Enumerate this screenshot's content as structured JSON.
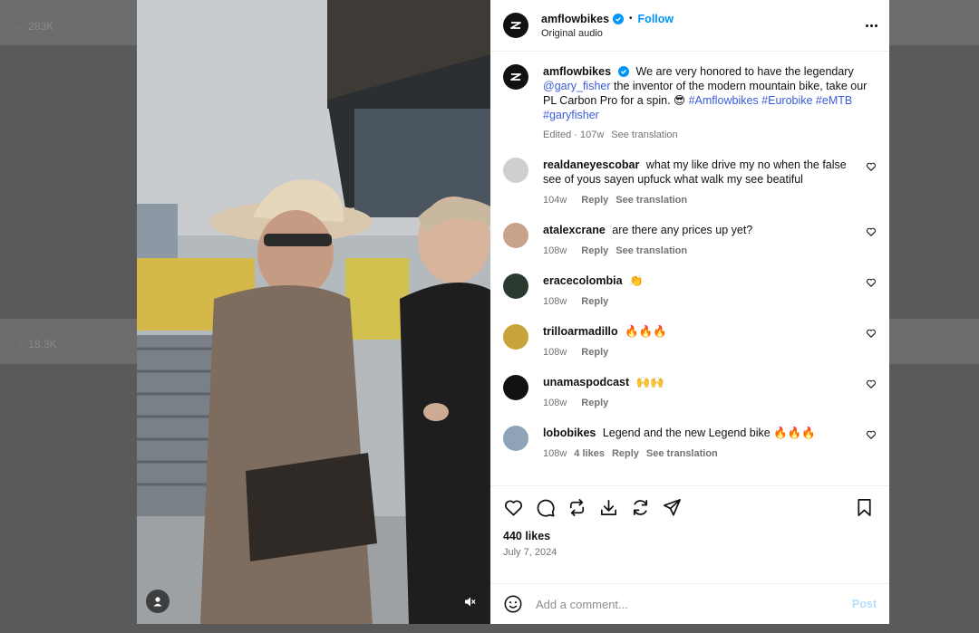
{
  "background": {
    "counts": [
      {
        "icon": "comment-icon",
        "value": "283K"
      },
      {
        "icon": "comment-icon",
        "value": "18.3K"
      }
    ]
  },
  "post": {
    "author": "amflowbikes",
    "follow_label": "Follow",
    "audio": "Original audio",
    "caption": {
      "text_1": "We are very honored to have the legendary",
      "mention": "@gary_fisher",
      "text_2": "the inventor of the modern mountain bike, take our PL Carbon Pro for a spin. 😎",
      "hashtags": "#Amflowbikes #Eurobike #eMTB #garyfisher",
      "edited": "Edited",
      "age": "107w",
      "see_translation": "See translation"
    },
    "comments": [
      {
        "user": "realdaneyescobar",
        "text": "what my like drive my no when the false see of yous sayen upfuck what walk my see beatiful",
        "age": "104w",
        "likes": "",
        "reply": "Reply",
        "translation": "See translation",
        "avatar_color": "#cfcfcf"
      },
      {
        "user": "atalexcrane",
        "text": "are there any prices up yet?",
        "age": "108w",
        "likes": "",
        "reply": "Reply",
        "translation": "See translation",
        "avatar_color": "#c9a28a"
      },
      {
        "user": "eracecolombia",
        "text": "👏",
        "age": "108w",
        "likes": "",
        "reply": "Reply",
        "translation": "",
        "avatar_color": "#2b3a2e"
      },
      {
        "user": "trilloarmadillo",
        "text": "🔥🔥🔥",
        "age": "108w",
        "likes": "",
        "reply": "Reply",
        "translation": "",
        "avatar_color": "#c8a23a"
      },
      {
        "user": "unamaspodcast",
        "text": "🙌🙌",
        "age": "108w",
        "likes": "",
        "reply": "Reply",
        "translation": "",
        "avatar_color": "#111111"
      },
      {
        "user": "lobobikes",
        "text": "Legend and the new Legend bike 🔥🔥🔥",
        "age": "108w",
        "likes": "4 likes",
        "reply": "Reply",
        "translation": "See translation",
        "avatar_color": "#8fa3b6"
      }
    ],
    "likes": "440 likes",
    "date": "July 7, 2024",
    "add_comment_placeholder": "Add a comment...",
    "post_label": "Post"
  },
  "colors": {
    "accent": "#0095f6",
    "hashtag": "#3b5bdb"
  }
}
